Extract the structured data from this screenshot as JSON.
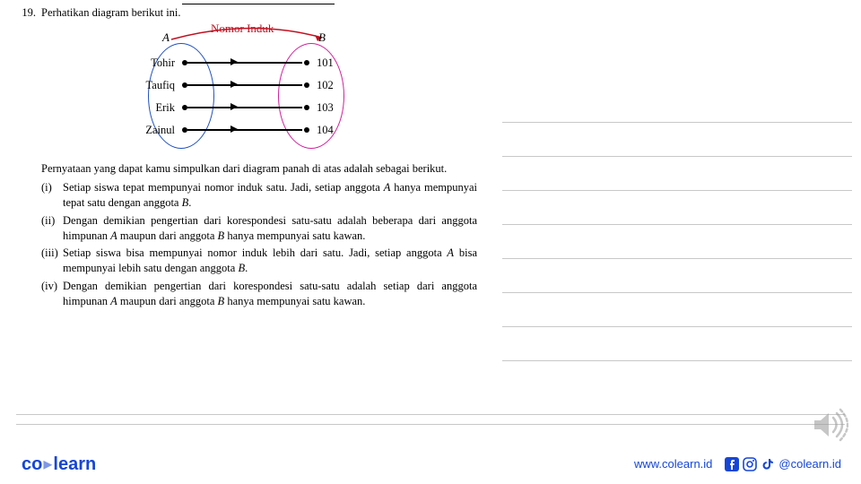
{
  "question": {
    "number": "19.",
    "text": "Perhatikan diagram berikut ini."
  },
  "diagram": {
    "title": "Nomor Induk",
    "setA_label": "A",
    "setB_label": "B",
    "rows": [
      {
        "a": "Tohir",
        "b": "101"
      },
      {
        "a": "Taufiq",
        "b": "102"
      },
      {
        "a": "Erik",
        "b": "103"
      },
      {
        "a": "Zainul",
        "b": "104"
      }
    ]
  },
  "explanation": "Pernyataan yang dapat kamu simpulkan dari diagram panah di atas adalah sebagai berikut.",
  "items": [
    {
      "label": "(i)",
      "text_before": "Setiap siswa tepat mempunyai nomor induk satu. Jadi, setiap anggota ",
      "italic1": "A",
      "mid1": " hanya mempunyai tepat satu dengan anggota ",
      "italic2": "B",
      "tail": "."
    },
    {
      "label": "(ii)",
      "text_before": "Dengan demikian pengertian dari korespondesi satu-satu adalah beberapa dari anggota himpunan ",
      "italic1": "A",
      "mid1": " maupun dari anggota ",
      "italic2": "B",
      "tail": " hanya mempunyai satu kawan."
    },
    {
      "label": "(iii)",
      "text_before": "Setiap siswa bisa mempunyai nomor induk lebih dari satu. Jadi, setiap anggota ",
      "italic1": "A",
      "mid1": " bisa mempunyai lebih satu dengan anggota ",
      "italic2": "B",
      "tail": "."
    },
    {
      "label": "(iv)",
      "text_before": "Dengan demikian pengertian dari korespondesi satu-satu adalah setiap dari anggota himpunan ",
      "italic1": "A",
      "mid1": " maupun dari anggota ",
      "italic2": "B",
      "tail": " hanya mempunyai satu kawan."
    }
  ],
  "footer": {
    "logo_a": "co",
    "logo_b": "learn",
    "url": "www.colearn.id",
    "handle": "@colearn.id"
  }
}
